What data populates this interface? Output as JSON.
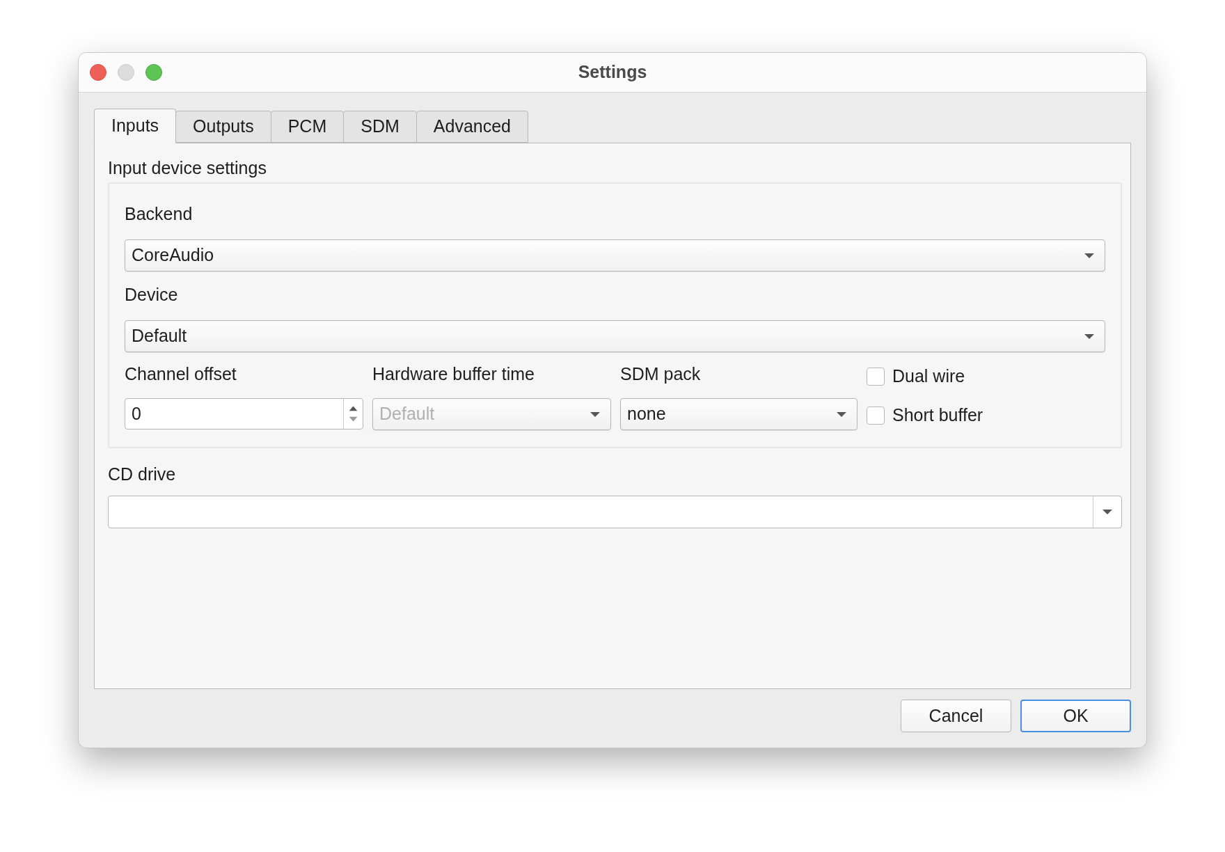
{
  "window": {
    "title": "Settings"
  },
  "tabs": [
    {
      "label": "Inputs",
      "selected": true
    },
    {
      "label": "Outputs",
      "selected": false
    },
    {
      "label": "PCM",
      "selected": false
    },
    {
      "label": "SDM",
      "selected": false
    },
    {
      "label": "Advanced",
      "selected": false
    }
  ],
  "group": {
    "title": "Input device settings"
  },
  "backend": {
    "label": "Backend",
    "value": "CoreAudio"
  },
  "device": {
    "label": "Device",
    "value": "Default"
  },
  "channel_offset": {
    "label": "Channel offset",
    "value": "0"
  },
  "hardware_buffer_time": {
    "label": "Hardware buffer time",
    "value": "Default",
    "disabled": true
  },
  "sdm_pack": {
    "label": "SDM pack",
    "value": "none",
    "disabled": false
  },
  "checkboxes": [
    {
      "label": "Dual wire",
      "checked": false
    },
    {
      "label": "Short buffer",
      "checked": false
    }
  ],
  "cd_drive": {
    "label": "CD drive"
  },
  "buttons": [
    {
      "label": "Cancel",
      "default": false
    },
    {
      "label": "OK",
      "default": true
    }
  ]
}
